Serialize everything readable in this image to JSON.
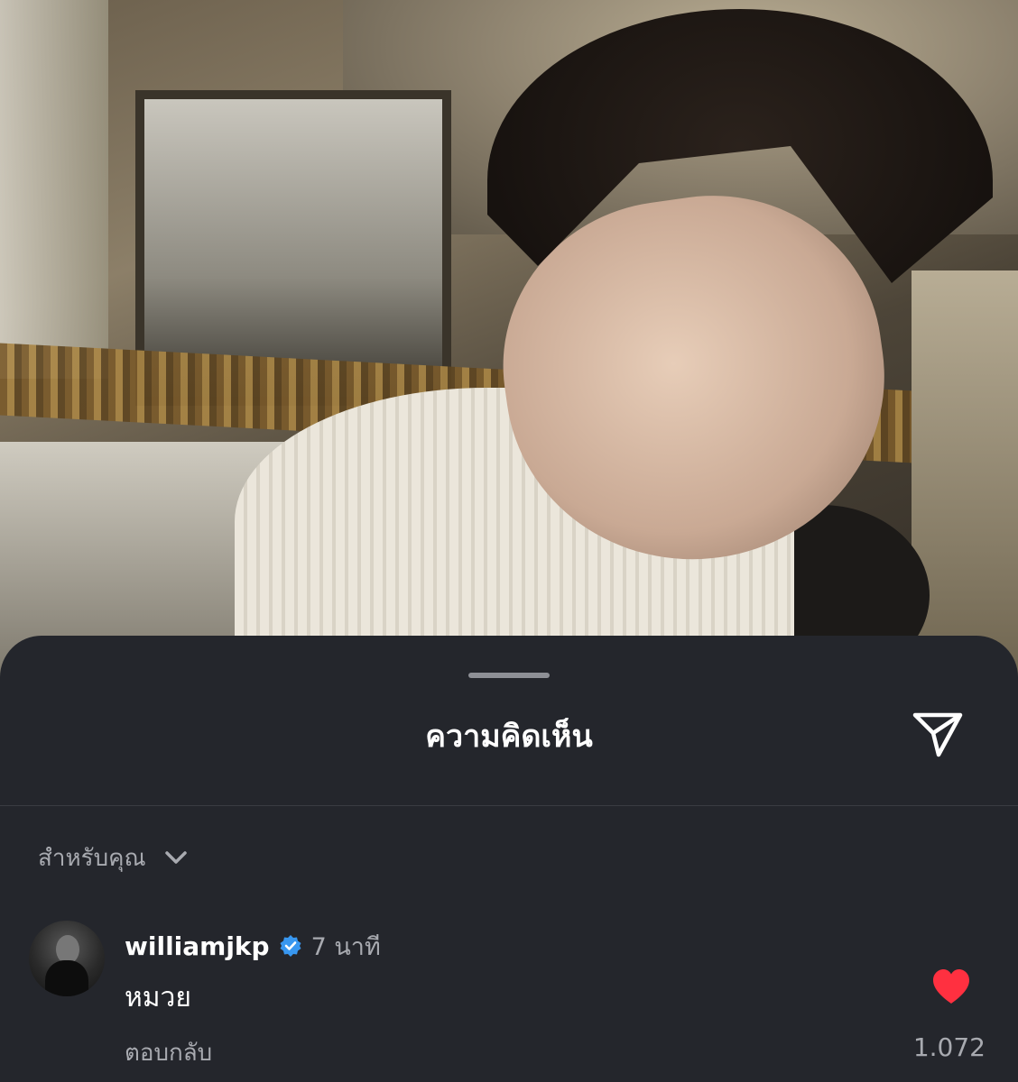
{
  "sheet": {
    "title": "ความคิดเห็น",
    "share_icon": "send-icon"
  },
  "filter": {
    "label": "สำหรับคุณ",
    "icon": "chevron-down-icon"
  },
  "comment": {
    "username": "williamjkp",
    "verified": true,
    "time": "7 นาที",
    "text": "หมวย",
    "reply_label": "ตอบกลับ",
    "liked": true,
    "like_count": "1.072"
  },
  "colors": {
    "sheet_bg": "#24262c",
    "secondary_text": "#a8aab0",
    "like_red": "#ff3040",
    "verified_blue": "#3897f0"
  }
}
